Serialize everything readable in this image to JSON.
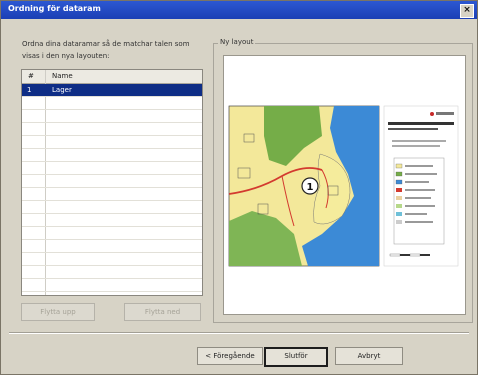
{
  "dialog": {
    "title": "Ordning för dataram",
    "close_glyph": "×"
  },
  "instructions": "Ordna dina dataramar så de matchar talen som visas i den nya layouten:",
  "table": {
    "headers": {
      "num": "#",
      "name": "Name"
    },
    "rows": [
      {
        "num": "1",
        "name": "Lager"
      }
    ]
  },
  "buttons": {
    "move_up": "Flytta upp",
    "move_down": "Flytta ned",
    "back": "< Föregående",
    "finish": "Slutför",
    "cancel": "Avbryt"
  },
  "layout_group": {
    "label": "Ny layout"
  },
  "map_marker": "1",
  "colors": {
    "titlebar": "#1d44bf",
    "selection": "#0e2d86",
    "water": "#3c8ad6",
    "land": "#f5ea9c",
    "forest": "#77b04a"
  }
}
